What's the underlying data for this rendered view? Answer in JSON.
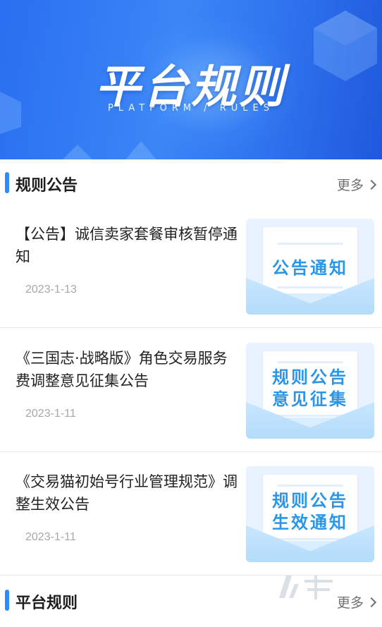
{
  "banner": {
    "title": "平台规则",
    "subtitle": "PLATFORM / RULES"
  },
  "announcements_section": {
    "title": "规则公告",
    "more_label": "更多"
  },
  "announcements": [
    {
      "title": "【公告】诚信卖家套餐审核暂停通知",
      "date": "2023-1-13",
      "thumb_lines": [
        "公告通知"
      ]
    },
    {
      "title": "《三国志·战略版》角色交易服务费调整意见征集公告",
      "date": "2023-1-11",
      "thumb_lines": [
        "规则公告",
        "意见征集"
      ]
    },
    {
      "title": "《交易猫初始号行业管理规范》调整生效公告",
      "date": "2023-1-11",
      "thumb_lines": [
        "规则公告",
        "生效通知"
      ]
    }
  ],
  "rules_section": {
    "title": "平台规则",
    "more_label": "更多"
  },
  "colors": {
    "accent": "#2f8cf5",
    "banner_blue": "#2f74ee",
    "thumb_text": "#2a96e8",
    "date_gray": "#a8a8a8"
  },
  "icons": {
    "more": "chevron-right-icon",
    "watermark": "jiuyou-watermark-logo"
  }
}
